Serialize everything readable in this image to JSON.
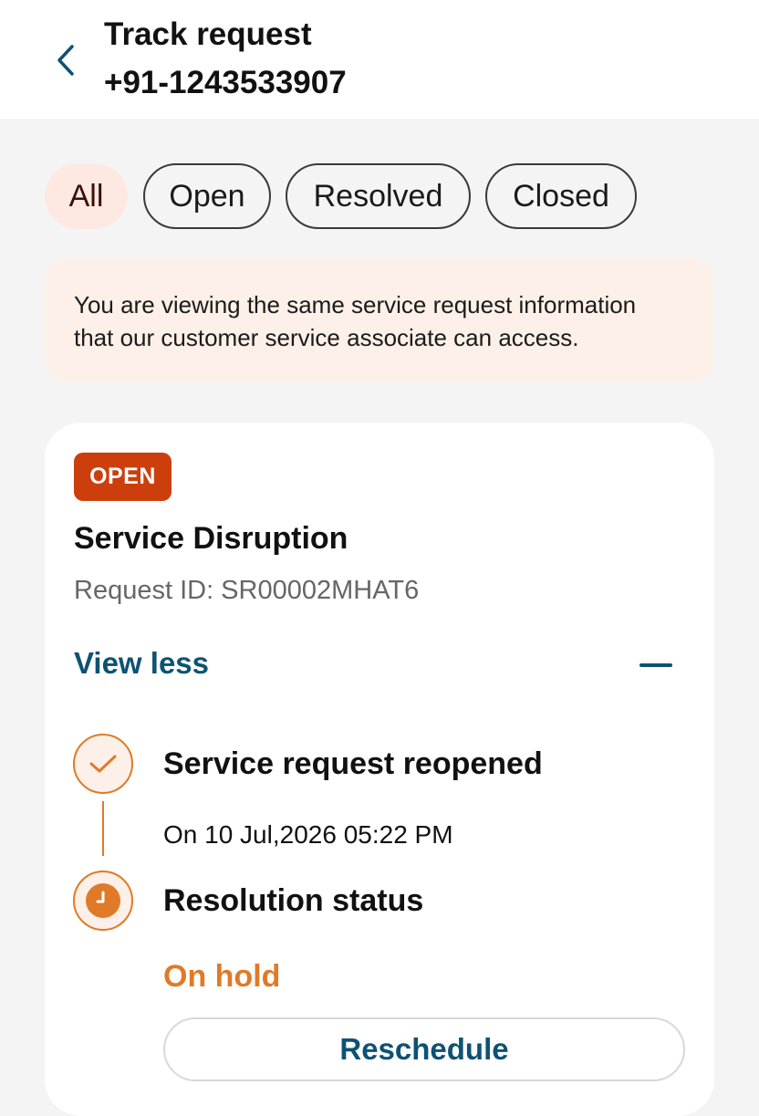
{
  "header": {
    "title": "Track request",
    "subtitle": "+91-1243533907"
  },
  "filters": [
    {
      "label": "All",
      "active": true
    },
    {
      "label": "Open",
      "active": false
    },
    {
      "label": "Resolved",
      "active": false
    },
    {
      "label": "Closed",
      "active": false
    }
  ],
  "info": {
    "line1": "You are viewing the same service request information",
    "line2": "that our customer service associate can access."
  },
  "request": {
    "status_badge": "OPEN",
    "title": "Service Disruption",
    "request_id": "Request ID: SR00002MHAT6",
    "toggle_label": "View less",
    "timeline": [
      {
        "title": "Service request reopened",
        "detail": "On 10 Jul,2026 05:22 PM",
        "icon": "check-icon"
      },
      {
        "title": "Resolution status",
        "detail": "On hold",
        "icon": "clock-icon"
      }
    ],
    "action_label": "Reschedule"
  },
  "colors": {
    "accent_orange": "#e07a28",
    "badge_red": "#cc3f0c",
    "link_blue": "#0d5273",
    "active_chip_bg": "#fde9e2",
    "info_bg": "#fdf0e8"
  }
}
